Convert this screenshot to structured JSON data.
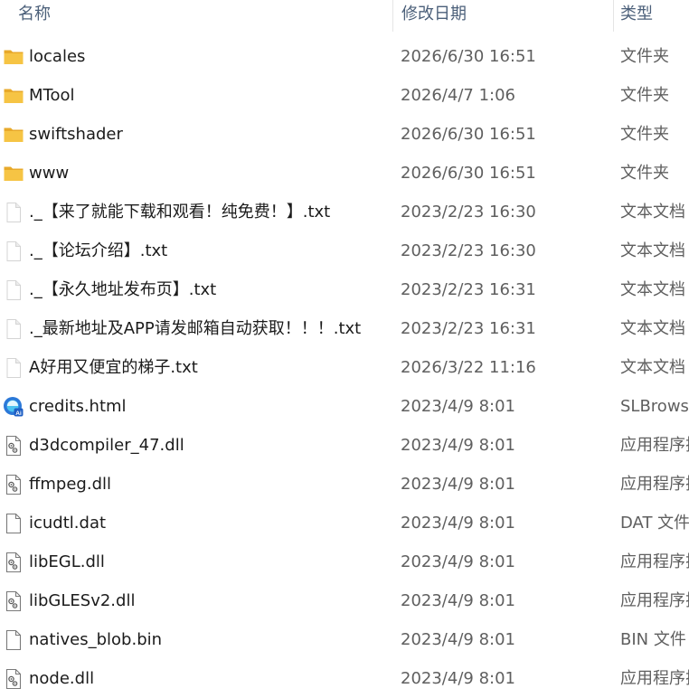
{
  "columns": {
    "name": "名称",
    "date": "修改日期",
    "type": "类型",
    "sort_indicator": "^"
  },
  "colors": {
    "folder": "#f6c444",
    "folder_dark": "#e8a92a",
    "header_text": "#4c607a",
    "secondary_text": "#5f5f5f"
  },
  "files": [
    {
      "name": "locales",
      "date": "2026/6/30 16:51",
      "type": "文件夹",
      "icon": "folder-icon"
    },
    {
      "name": "MTool",
      "date": "2026/4/7 1:06",
      "type": "文件夹",
      "icon": "folder-icon"
    },
    {
      "name": "swiftshader",
      "date": "2026/6/30 16:51",
      "type": "文件夹",
      "icon": "folder-icon"
    },
    {
      "name": "www",
      "date": "2026/6/30 16:51",
      "type": "文件夹",
      "icon": "folder-icon"
    },
    {
      "name": "._【来了就能下载和观看！纯免费！】.txt",
      "date": "2023/2/23 16:30",
      "type": "文本文档",
      "icon": "text-file-icon"
    },
    {
      "name": "._【论坛介绍】.txt",
      "date": "2023/2/23 16:30",
      "type": "文本文档",
      "icon": "text-file-icon"
    },
    {
      "name": "._【永久地址发布页】.txt",
      "date": "2023/2/23 16:31",
      "type": "文本文档",
      "icon": "text-file-icon"
    },
    {
      "name": "._最新地址及APP请发邮箱自动获取！！！.txt",
      "date": "2023/2/23 16:31",
      "type": "文本文档",
      "icon": "text-file-icon"
    },
    {
      "name": "A好用又便宜的梯子.txt",
      "date": "2026/3/22 11:16",
      "type": "文本文档",
      "icon": "text-file-icon"
    },
    {
      "name": "credits.html",
      "date": "2023/4/9 8:01",
      "type": "SLBrowse",
      "icon": "browser-icon"
    },
    {
      "name": "d3dcompiler_47.dll",
      "date": "2023/4/9 8:01",
      "type": "应用程序扩",
      "icon": "dll-file-icon"
    },
    {
      "name": "ffmpeg.dll",
      "date": "2023/4/9 8:01",
      "type": "应用程序扩",
      "icon": "dll-file-icon"
    },
    {
      "name": "icudtl.dat",
      "date": "2023/4/9 8:01",
      "type": "DAT 文件",
      "icon": "blank-file-icon"
    },
    {
      "name": "libEGL.dll",
      "date": "2023/4/9 8:01",
      "type": "应用程序扩",
      "icon": "dll-file-icon"
    },
    {
      "name": "libGLESv2.dll",
      "date": "2023/4/9 8:01",
      "type": "应用程序扩",
      "icon": "dll-file-icon"
    },
    {
      "name": "natives_blob.bin",
      "date": "2023/4/9 8:01",
      "type": "BIN 文件",
      "icon": "blank-file-icon"
    },
    {
      "name": "node.dll",
      "date": "2023/4/9 8:01",
      "type": "应用程序扩",
      "icon": "dll-file-icon"
    }
  ]
}
